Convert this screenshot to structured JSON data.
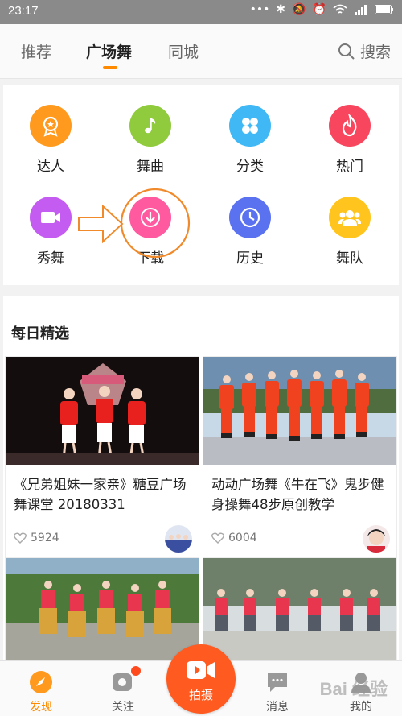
{
  "status": {
    "time": "23:17"
  },
  "tabs": [
    {
      "label": "推荐"
    },
    {
      "label": "广场舞"
    },
    {
      "label": "同城"
    }
  ],
  "search": {
    "label": "搜索"
  },
  "grid": [
    {
      "label": "达人",
      "icon": "badge-icon",
      "color": "#ff9a1e"
    },
    {
      "label": "舞曲",
      "icon": "music-note-icon",
      "color": "#8fcb3c"
    },
    {
      "label": "分类",
      "icon": "category-icon",
      "color": "#40b8f5"
    },
    {
      "label": "热门",
      "icon": "flame-icon",
      "color": "#f7465d"
    },
    {
      "label": "秀舞",
      "icon": "video-camera-icon",
      "color": "#c45cf2"
    },
    {
      "label": "下载",
      "icon": "download-icon",
      "color": "#ff5aa0"
    },
    {
      "label": "历史",
      "icon": "clock-icon",
      "color": "#5b72f0"
    },
    {
      "label": "舞队",
      "icon": "group-icon",
      "color": "#ffc41e"
    }
  ],
  "section": {
    "title": "每日精选"
  },
  "cards": [
    {
      "title": "《兄弟姐妹一家亲》糖豆广场舞课堂 20180331",
      "likes": "5924"
    },
    {
      "title": "动动广场舞《牛在飞》鬼步健身操舞48步原创教学",
      "likes": "6004"
    },
    {
      "title": "",
      "likes": ""
    },
    {
      "title": "",
      "likes": ""
    }
  ],
  "bottom": {
    "discover": "发现",
    "follow": "关注",
    "shoot": "拍摄",
    "messages": "消息",
    "mine": "我的"
  },
  "colors": {
    "accent": "#ff8a00",
    "shoot": "#ff5a1f"
  },
  "watermark": "Bai 经验"
}
